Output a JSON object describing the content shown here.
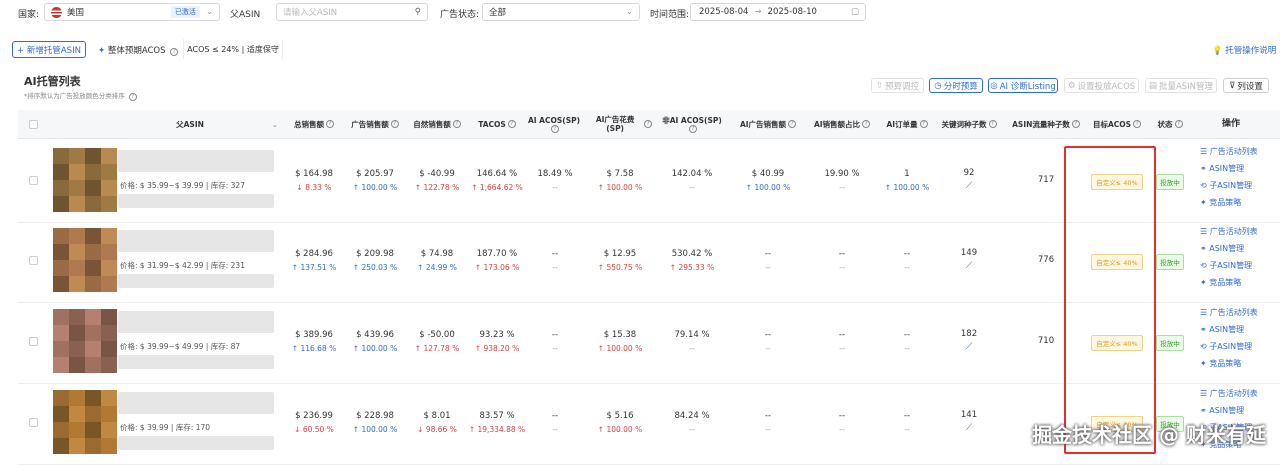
{
  "filters": {
    "country_label": "国家:",
    "country_value": "美国",
    "country_badge": "已激活",
    "parent_asin_label": "父ASIN",
    "parent_asin_placeholder": "请输入父ASIN",
    "ad_status_label": "广告状态:",
    "ad_status_value": "全部",
    "time_range_label": "时间范围:",
    "date_start": "2025-08-04",
    "date_arrow": "→",
    "date_end": "2025-08-10"
  },
  "toolbar": {
    "add_button": "+ 新增托管ASIN",
    "overall_acos_label": "整体预期ACOS",
    "acos_rule": "ACOS ≤ 24% | 适度保守",
    "help_link": "托管操作说明"
  },
  "list": {
    "title": "AI托管列表",
    "subtitle": "*排序默认为广告投放颜色分类排序",
    "actions": [
      "预算调控",
      "分时预算",
      "AI 诊断Listing",
      "设置投放ACOS",
      "批量ASIN管理",
      "列设置"
    ]
  },
  "columns": [
    "父ASIN",
    "总销售额",
    "广告销售额",
    "自然销售额",
    "TACOS",
    "AI ACOS(SP)",
    "AI广告花费(SP)",
    "非AI ACOS(SP)",
    "AI广告销售额",
    "AI销售额占比",
    "AI订单量",
    "关键词种子数",
    "ASIN流量种子数",
    "目标ACOS",
    "状态",
    "操作"
  ],
  "rows": [
    {
      "price": "价格: $ 35.99~$ 39.99 | 库存: 327",
      "total_sales": "$ 164.98",
      "total_sales_chg": "↓ 8.33 %",
      "total_dir": "down",
      "ad_sales": "$ 205.97",
      "ad_sales_chg": "↑ 100.00 %",
      "ad_dir": "up-blue",
      "organic": "$ -40.99",
      "organic_chg": "↑ 122.78 %",
      "organic_dir": "up-red",
      "tacos": "146.64 %",
      "tacos_chg": "↑ 1,664.62 %",
      "tacos_dir": "up-red",
      "ai_acos": "18.49 %",
      "ai_acos_chg": "--",
      "ai_spend": "$ 7.58",
      "ai_spend_chg": "↑ 100.00 %",
      "non_ai_acos": "142.04 %",
      "non_ai_acos_chg": "--",
      "ai_ad_sales": "$ 40.99",
      "ai_ad_sales_chg": "↑ 100.00 %",
      "ai_share": "19.90 %",
      "ai_share_chg": "--",
      "ai_orders": "1",
      "ai_orders_chg": "↑ 100.00 %",
      "kw_seeds": "92",
      "asin_seeds": "717",
      "target": "自定义≤ 40%",
      "status": "投放中"
    },
    {
      "price": "价格: $ 31.99~$ 42.99 | 库存: 231",
      "total_sales": "$ 284.96",
      "total_sales_chg": "↑ 137.51 %",
      "total_dir": "up-blue",
      "ad_sales": "$ 209.98",
      "ad_sales_chg": "↑ 250.03 %",
      "ad_dir": "up-blue",
      "organic": "$ 74.98",
      "organic_chg": "↑ 24.99 %",
      "organic_dir": "up-blue",
      "tacos": "187.70 %",
      "tacos_chg": "↑ 173.06 %",
      "tacos_dir": "up-red",
      "ai_acos": "--",
      "ai_acos_chg": "--",
      "ai_spend": "$ 12.95",
      "ai_spend_chg": "↑ 550.75 %",
      "non_ai_acos": "530.42 %",
      "non_ai_acos_chg": "↑ 295.33 %",
      "ai_ad_sales": "--",
      "ai_ad_sales_chg": "--",
      "ai_share": "--",
      "ai_share_chg": "--",
      "ai_orders": "--",
      "ai_orders_chg": "--",
      "kw_seeds": "149",
      "asin_seeds": "776",
      "target": "自定义≤ 40%",
      "status": "投放中"
    },
    {
      "price": "价格: $ 39.99~$ 49.99 | 库存: 87",
      "total_sales": "$ 389.96",
      "total_sales_chg": "↑ 116.68 %",
      "total_dir": "up-blue",
      "ad_sales": "$ 439.96",
      "ad_sales_chg": "↑ 100.00 %",
      "ad_dir": "up-blue",
      "organic": "$ -50.00",
      "organic_chg": "↑ 127.78 %",
      "organic_dir": "up-red",
      "tacos": "93.23 %",
      "tacos_chg": "↑ 938.20 %",
      "tacos_dir": "up-red",
      "ai_acos": "--",
      "ai_acos_chg": "--",
      "ai_spend": "$ 15.38",
      "ai_spend_chg": "↑ 100.00 %",
      "non_ai_acos": "79.14 %",
      "non_ai_acos_chg": "--",
      "ai_ad_sales": "--",
      "ai_ad_sales_chg": "--",
      "ai_share": "--",
      "ai_share_chg": "--",
      "ai_orders": "--",
      "ai_orders_chg": "--",
      "kw_seeds": "182",
      "asin_seeds": "710",
      "target": "自定义≤ 40%",
      "status": "投放中"
    },
    {
      "price": "价格: $ 39.99 | 库存: 170",
      "total_sales": "$ 236.99",
      "total_sales_chg": "↓ 60.50 %",
      "total_dir": "down",
      "ad_sales": "$ 228.98",
      "ad_sales_chg": "↑ 100.00 %",
      "ad_dir": "up-blue",
      "organic": "$ 8.01",
      "organic_chg": "↓ 98.66 %",
      "organic_dir": "down",
      "tacos": "83.57 %",
      "tacos_chg": "↑ 19,334.88 %",
      "tacos_dir": "up-red",
      "ai_acos": "--",
      "ai_acos_chg": "--",
      "ai_spend": "$ 5.16",
      "ai_spend_chg": "↑ 100.00 %",
      "non_ai_acos": "84.24 %",
      "non_ai_acos_chg": "--",
      "ai_ad_sales": "--",
      "ai_ad_sales_chg": "--",
      "ai_share": "--",
      "ai_share_chg": "--",
      "ai_orders": "--",
      "ai_orders_chg": "--",
      "kw_seeds": "141",
      "asin_seeds": "",
      "target": "自定义≤ 40%",
      "status": "投放中"
    }
  ],
  "row_actions": [
    "广告活动列表",
    "ASIN管理",
    "子ASIN管理",
    "竞品策略"
  ],
  "watermark": "掘金技术社区 @ 财米有延",
  "colors": {
    "accent": "#2f6bd8",
    "highlight_border": "#e03030",
    "up_red": "#e04040"
  }
}
